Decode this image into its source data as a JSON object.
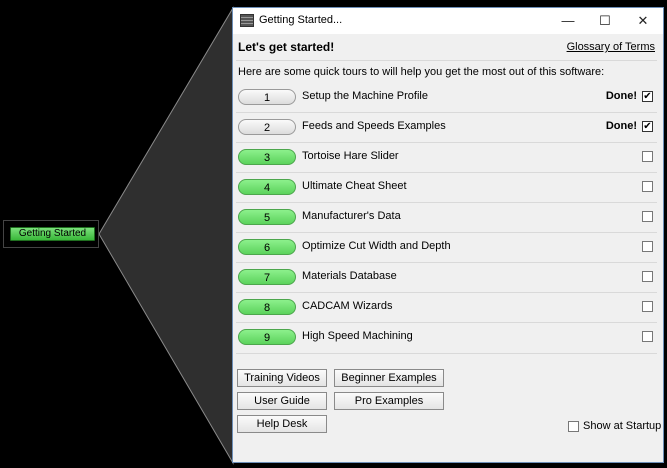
{
  "launcher": {
    "label": "Getting Started"
  },
  "window": {
    "title": "Getting Started...",
    "controls": {
      "minimize": "—",
      "maximize": "☐",
      "close": "✕"
    },
    "app_icon": "app-window-icon"
  },
  "content": {
    "heading": "Let's get started!",
    "glossary_link": "Glossary of Terms",
    "intro": "Here are some quick tours to will help you get the most out of this software:"
  },
  "tours": [
    {
      "number": "1",
      "label": "Setup the Machine Profile",
      "done": true,
      "status": "Done!"
    },
    {
      "number": "2",
      "label": "Feeds and Speeds Examples",
      "done": true,
      "status": "Done!"
    },
    {
      "number": "3",
      "label": "Tortoise Hare Slider",
      "done": false,
      "status": ""
    },
    {
      "number": "4",
      "label": "Ultimate Cheat Sheet",
      "done": false,
      "status": ""
    },
    {
      "number": "5",
      "label": "Manufacturer's Data",
      "done": false,
      "status": ""
    },
    {
      "number": "6",
      "label": "Optimize Cut Width and Depth",
      "done": false,
      "status": ""
    },
    {
      "number": "7",
      "label": "Materials Database",
      "done": false,
      "status": ""
    },
    {
      "number": "8",
      "label": "CADCAM Wizards",
      "done": false,
      "status": ""
    },
    {
      "number": "9",
      "label": "High Speed Machining",
      "done": false,
      "status": ""
    }
  ],
  "footer": {
    "training_videos": "Training Videos",
    "beginner_examples": "Beginner Examples",
    "user_guide": "User Guide",
    "pro_examples": "Pro Examples",
    "help_desk": "Help Desk",
    "show_at_startup": "Show at Startup",
    "show_at_startup_checked": false
  },
  "colors": {
    "todo_button": "#5cd35c",
    "done_button": "#e6e6e6",
    "window_border": "#6d8fb8",
    "cone": "#2f2f2f"
  }
}
